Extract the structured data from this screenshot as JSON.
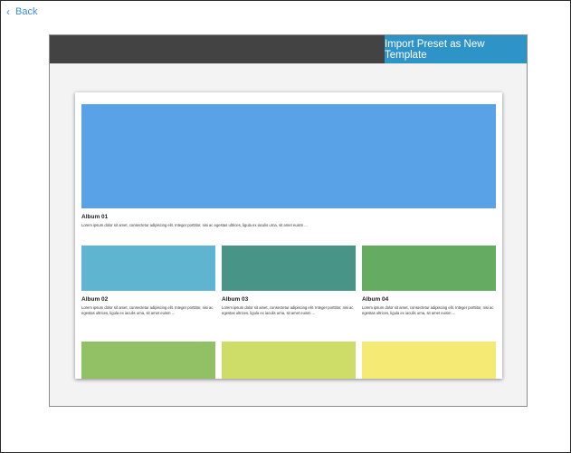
{
  "nav": {
    "back_label": "Back"
  },
  "toolbar": {
    "import_label": "Import Preset as New Template"
  },
  "colors": {
    "accent": "#2e93c6",
    "header_bg": "#434343"
  },
  "albums": [
    {
      "title": "Album 01",
      "desc": "Lorem ipsum dolor sit amet, consectetur adipiscing elit. Integer porttitor, nisi ac egestas ultrices, ligula ex iaculis urna, sit amet euism ...",
      "color": "#5aa2e8"
    },
    {
      "title": "Album 02",
      "desc": "Lorem ipsum dolor sit amet, consectetur adipiscing elit. Integer porttitor, nisi ac egestas ultrices, ligula ex iaculis urna, sit amet euism ...",
      "color": "#5fb4cf"
    },
    {
      "title": "Album 03",
      "desc": "Lorem ipsum dolor sit amet, consectetur adipiscing elit. Integer porttitor, nisi ac egestas ultrices, ligula ex iaculis urna, sit amet euism ...",
      "color": "#489486"
    },
    {
      "title": "Album 04",
      "desc": "Lorem ipsum dolor sit amet, consectetur adipiscing elit. Integer porttitor, nisi ac egestas ultrices, ligula ex iaculis urna, sit amet euism ...",
      "color": "#65ab62"
    },
    {
      "title": "",
      "desc": "",
      "color": "#92c165"
    },
    {
      "title": "",
      "desc": "",
      "color": "#cddd67"
    },
    {
      "title": "",
      "desc": "",
      "color": "#f4ea74"
    }
  ]
}
